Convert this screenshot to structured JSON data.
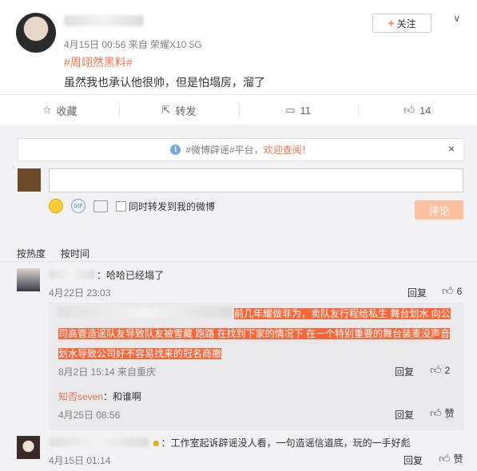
{
  "post": {
    "time_source": "4月15日 00:56 来自 荣耀X10 5G",
    "hashtag": "#周翊然黑料#",
    "text": "虽然我也承认他很帅，但是怕塌房，溜了",
    "follow_label": "关注"
  },
  "actions": [
    {
      "icon": "star-icon",
      "label": "收藏"
    },
    {
      "icon": "share-icon",
      "label": "转发"
    },
    {
      "icon": "comment-icon",
      "label": "11"
    },
    {
      "icon": "thumb-up-icon",
      "label": "14"
    }
  ],
  "notice": {
    "prefix": "#微博辟谣#平台，",
    "highlight": "欢迎查阅！"
  },
  "composer": {
    "repost_label": "同时转发到我的微博",
    "submit_label": "评论"
  },
  "sort": {
    "hot": "按热度",
    "time": "按时间"
  },
  "comments": [
    {
      "text": "：哈哈已经塌了",
      "time": "4月22日 23:03",
      "reply": "回复",
      "likes": "6"
    }
  ],
  "sub_comments": [
    {
      "lines": [
        "前几年耀做非为，卖队友行程给私生 舞台划水 向公",
        "司高管造谣队友导致队友被雪藏 跑路 在找到下家的情况下 在一个特别重要的舞台装麦没声音",
        "划水导致公司好不容易找来的冠名商撤"
      ],
      "time": "8月2日 15:14 来自重庆",
      "reply": "回复",
      "likes": "2"
    },
    {
      "name": "知否seven",
      "text": "：和谁啊",
      "time": "4月25日 08:56",
      "reply": "回复",
      "likes": "赞"
    }
  ],
  "comment2": {
    "text": "：工作室起诉辟谣没人看，一句造谣信道底，玩的一手好彪",
    "time": "4月15日 01:14",
    "reply": "回复",
    "likes": "赞"
  }
}
